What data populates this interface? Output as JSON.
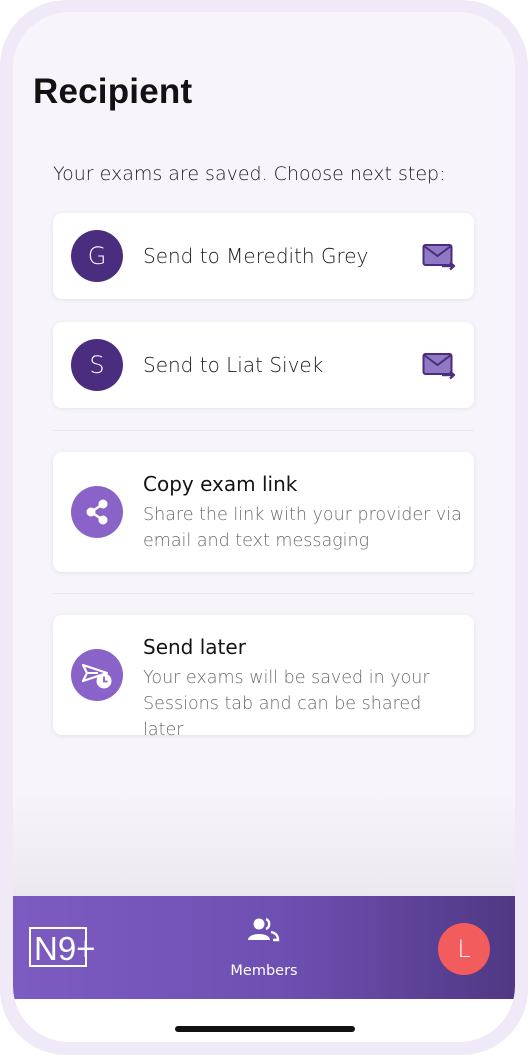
{
  "header": {
    "title": "Recipient"
  },
  "prompt": "Your exams are saved. Choose next step:",
  "recipients": [
    {
      "initial": "G",
      "label": "Send to Meredith Grey",
      "icon": "mail-send-icon"
    },
    {
      "initial": "S",
      "label": "Send to Liat Sivek",
      "icon": "mail-send-icon"
    }
  ],
  "actions": [
    {
      "title": "Copy exam link",
      "description": "Share the link with your provider via email and text messaging",
      "icon": "share-icon"
    },
    {
      "title": "Send later",
      "description": "Your exams will be saved in your Sessions tab and can be shared later",
      "icon": "send-later-icon"
    }
  ],
  "tabbar": {
    "logo_text": "N9+",
    "members_label": "Members",
    "profile_initial": "L"
  },
  "colors": {
    "primary": "#4b2d7f",
    "accent": "#8a63c8",
    "profile": "#f25c5c",
    "tabbar_start": "#7d5cc2",
    "tabbar_end": "#503883"
  }
}
